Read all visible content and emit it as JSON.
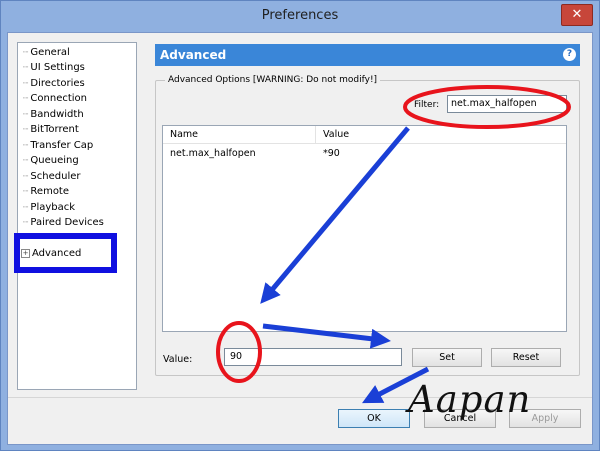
{
  "window": {
    "title": "Preferences",
    "close_glyph": "✕"
  },
  "sidebar": {
    "items": [
      {
        "label": "General"
      },
      {
        "label": "UI Settings"
      },
      {
        "label": "Directories"
      },
      {
        "label": "Connection"
      },
      {
        "label": "Bandwidth"
      },
      {
        "label": "BitTorrent"
      },
      {
        "label": "Transfer Cap"
      },
      {
        "label": "Queueing"
      },
      {
        "label": "Scheduler"
      },
      {
        "label": "Remote"
      },
      {
        "label": "Playback"
      },
      {
        "label": "Paired Devices"
      },
      {
        "label": "Advanced",
        "expander": "+",
        "selected": true
      }
    ]
  },
  "panel": {
    "title": "Advanced",
    "help_glyph": "?",
    "group_label": "Advanced Options [WARNING: Do not modify!]",
    "filter": {
      "label": "Filter:",
      "value": "net.max_halfopen"
    },
    "table": {
      "columns": [
        "Name",
        "Value"
      ],
      "rows": [
        {
          "name": "net.max_halfopen",
          "value": "*90"
        }
      ]
    },
    "value": {
      "label": "Value:",
      "value": "90"
    },
    "set_label": "Set",
    "reset_label": "Reset"
  },
  "footer": {
    "ok_label": "OK",
    "cancel_label": "Cancel",
    "apply_label": "Apply"
  },
  "annotations": {
    "watermark": "Aapan",
    "circle_color": "#e8141c",
    "highlight_color": "#1010e0",
    "arrow_color": "#1a3fd6"
  }
}
